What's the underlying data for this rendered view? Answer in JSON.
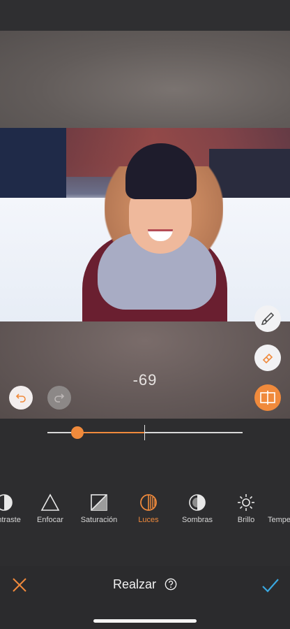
{
  "editor": {
    "adjustment_value": "-69",
    "slider_value": -69,
    "slider_min": -100,
    "slider_max": 100
  },
  "tools": [
    {
      "label": "Contraste",
      "icon": "contrast-icon",
      "active": false
    },
    {
      "label": "Enfocar",
      "icon": "triangle-icon",
      "active": false
    },
    {
      "label": "Saturación",
      "icon": "saturation-icon",
      "active": false
    },
    {
      "label": "Luces",
      "icon": "highlights-icon",
      "active": true
    },
    {
      "label": "Sombras",
      "icon": "shadows-icon",
      "active": false
    },
    {
      "label": "Brillo",
      "icon": "sun-icon",
      "active": false
    },
    {
      "label": "Temperatura",
      "icon": "temperature-icon",
      "active": false
    }
  ],
  "bottom_bar": {
    "title": "Realzar"
  },
  "colors": {
    "accent": "#f08a3c",
    "confirm": "#3aa8e0",
    "background": "#2d2d2f"
  }
}
